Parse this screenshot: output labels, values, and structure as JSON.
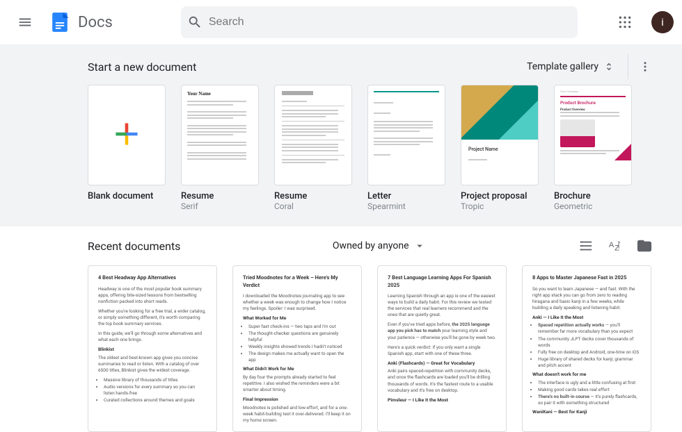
{
  "header": {
    "app_name": "Docs",
    "search_placeholder": "Search",
    "avatar_letter": "i"
  },
  "template_section": {
    "title": "Start a new document",
    "gallery_label": "Template gallery",
    "templates": [
      {
        "name": "Blank document",
        "subtitle": ""
      },
      {
        "name": "Resume",
        "subtitle": "Serif"
      },
      {
        "name": "Resume",
        "subtitle": "Coral"
      },
      {
        "name": "Letter",
        "subtitle": "Spearmint"
      },
      {
        "name": "Project proposal",
        "subtitle": "Tropic"
      },
      {
        "name": "Brochure",
        "subtitle": "Geometric"
      }
    ]
  },
  "recent_section": {
    "title": "Recent documents",
    "filter_label": "Owned by anyone",
    "documents": [
      {
        "title": "4 Best Headway App Alternatives"
      },
      {
        "title": "Tried Moodnotes for a Week – Here's My Verdict"
      },
      {
        "title": "7 Best Language Learning Apps For Spanish 2025"
      },
      {
        "title": "8 Apps to Master Japanese Fast in 2025"
      }
    ]
  }
}
